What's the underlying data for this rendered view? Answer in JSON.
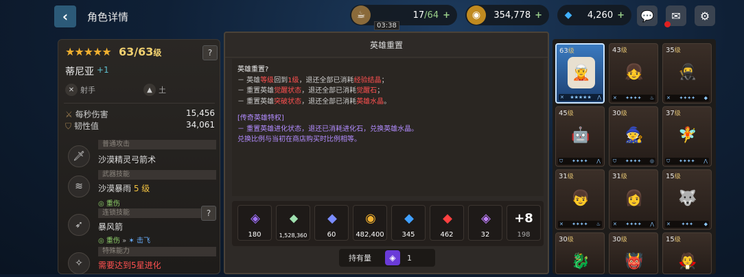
{
  "header": {
    "title": "角色详情",
    "stamina": {
      "value": "17",
      "max": "/64",
      "timer": "03:38"
    },
    "gold": "354,778",
    "gems": "4,260",
    "plus": "+"
  },
  "hero": {
    "stars": "★★★★★",
    "level": "63",
    "max_level": "/63",
    "level_unit": "级",
    "name": "蒂尼亚",
    "plus": "+1",
    "class": "射手",
    "element": "土",
    "help": "?"
  },
  "stats": [
    {
      "label": "每秒伤害",
      "value": "15,456"
    },
    {
      "label": "韧性值",
      "value": "34,061"
    }
  ],
  "skills": [
    {
      "category": "普通攻击",
      "name": "沙漠精灵弓箭术",
      "level": "",
      "tags": []
    },
    {
      "category": "武器技能",
      "name": "沙漠暴雨",
      "level": "5 级",
      "tags": [
        "重伤"
      ]
    },
    {
      "category": "连锁技能",
      "name": "暴风箭",
      "level": "",
      "tags": [
        "重伤",
        "击飞"
      ]
    },
    {
      "category": "特殊能力",
      "name": "需要达到5星进化",
      "level": "",
      "tags": []
    }
  ],
  "dialog": {
    "title": "英雄重置",
    "question": "英雄重置?",
    "lines": [
      {
        "pre": "－ 英雄",
        "h1": "等级",
        "mid": "回到",
        "h2": "1级",
        "mid2": "，退还全部已消耗",
        "h3": "经验结晶",
        "post": "；"
      },
      {
        "pre": "－ 重置英雄",
        "h1": "觉醒状态",
        "mid": "，退还全部已消耗",
        "h2": "觉醒石",
        "post": "；"
      },
      {
        "pre": "－ 重置英雄",
        "h1": "突破状态",
        "mid": "，退还全部已消耗",
        "h2": "英雄水晶",
        "post": "。"
      }
    ],
    "legend_title": "[传奇英雄特权]",
    "legend_line1": "－ 重置英雄进化状态，退还已消耗进化石，兑换英雄水晶。",
    "legend_line2": "兑换比例与当初在商店购买时比例相等。",
    "items": [
      {
        "icon": "purple-crystal-icon",
        "count": "180",
        "color": "#a070ff"
      },
      {
        "icon": "green-crystal-icon",
        "count": "1,528,360",
        "color": "#9fe0b0"
      },
      {
        "icon": "blue-purple-gem-icon",
        "count": "60",
        "color": "#7a8cff"
      },
      {
        "icon": "gold-coin-icon",
        "count": "482,400",
        "color": "#f0b030"
      },
      {
        "icon": "blue-gem-icon",
        "count": "345",
        "color": "#40a0ff"
      },
      {
        "icon": "red-gem-icon",
        "count": "462",
        "color": "#ff4040"
      },
      {
        "icon": "rainbow-gem-icon",
        "count": "32",
        "color": "#c080ff"
      }
    ],
    "more": {
      "label": "+8",
      "count": "198"
    },
    "owned_label": "持有量",
    "owned_count": "1"
  },
  "heroes": [
    {
      "level": "63",
      "unit": "级",
      "emoji": "🧝"
    },
    {
      "level": "43",
      "unit": "级",
      "emoji": "👧"
    },
    {
      "level": "35",
      "unit": "级",
      "emoji": "🥷"
    },
    {
      "level": "45",
      "unit": "级",
      "emoji": "🤖"
    },
    {
      "level": "30",
      "unit": "级",
      "emoji": "🧙"
    },
    {
      "level": "37",
      "unit": "级",
      "emoji": "🧚"
    },
    {
      "level": "31",
      "unit": "级",
      "emoji": "👦"
    },
    {
      "level": "31",
      "unit": "级",
      "emoji": "👩"
    },
    {
      "level": "15",
      "unit": "级",
      "emoji": "🐺"
    },
    {
      "level": "30",
      "unit": "级",
      "emoji": "🐉"
    },
    {
      "level": "30",
      "unit": "级",
      "emoji": "👹"
    },
    {
      "level": "15",
      "unit": "级",
      "emoji": "🧛"
    }
  ]
}
